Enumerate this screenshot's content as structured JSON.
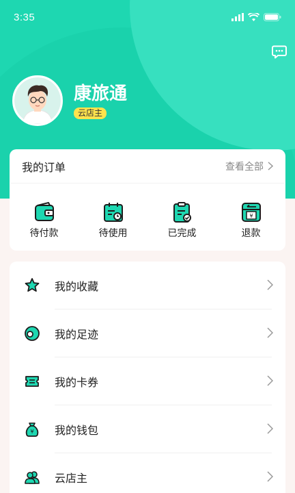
{
  "status_bar": {
    "time": "3:35"
  },
  "profile": {
    "name": "康旅通",
    "badge": "云店主"
  },
  "orders": {
    "title": "我的订单",
    "view_all": "查看全部",
    "items": [
      {
        "label": "待付款",
        "icon": "wallet-icon"
      },
      {
        "label": "待使用",
        "icon": "calendar-icon"
      },
      {
        "label": "已完成",
        "icon": "clipboard-check-icon"
      },
      {
        "label": "退款",
        "icon": "refund-icon"
      }
    ]
  },
  "menu": {
    "items": [
      {
        "label": "我的收藏",
        "icon": "star-icon"
      },
      {
        "label": "我的足迹",
        "icon": "footprint-icon"
      },
      {
        "label": "我的卡券",
        "icon": "coupon-icon"
      },
      {
        "label": "我的钱包",
        "icon": "money-bag-icon"
      },
      {
        "label": "云店主",
        "icon": "users-icon"
      }
    ]
  },
  "colors": {
    "primary": "#1ed7b1",
    "dark": "#1c1c1c",
    "badge": "#ffe34d"
  }
}
